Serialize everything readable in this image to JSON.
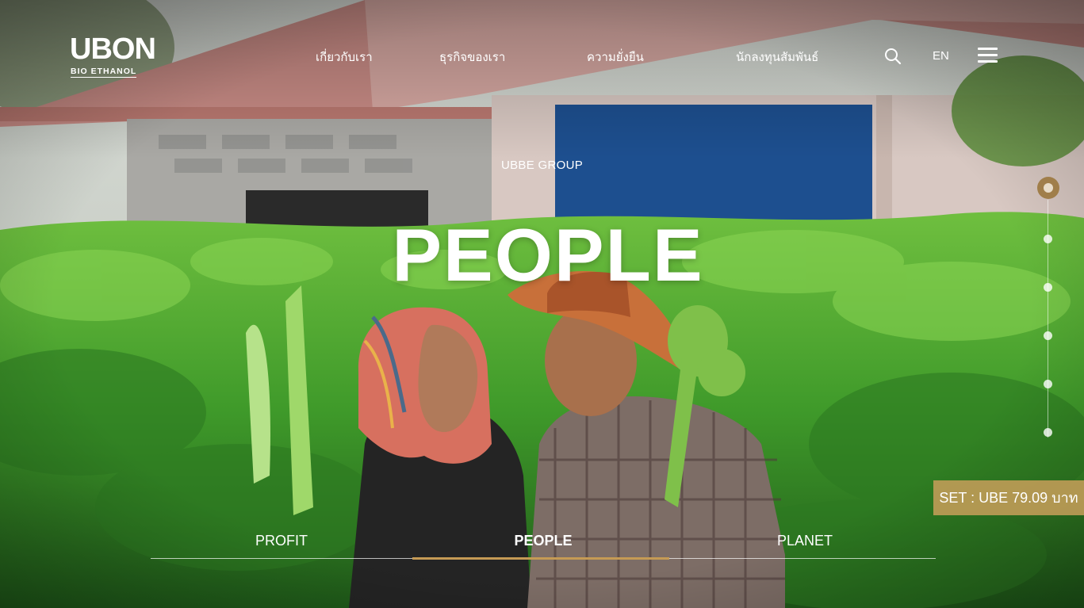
{
  "brand": {
    "name": "UBON",
    "tagline": "BIO ETHANOL"
  },
  "nav": {
    "items": [
      {
        "label": "เกี่ยวกับเรา"
      },
      {
        "label": "ธุรกิจของเรา"
      },
      {
        "label": "ความยั่งยืน"
      },
      {
        "label": "นักลงทุนสัมพันธ์"
      }
    ],
    "language": "EN"
  },
  "hero": {
    "eyebrow": "UBBE GROUP",
    "headline": "PEOPLE",
    "active_slide": 1,
    "slide_count": 6
  },
  "stock": {
    "text": "SET : UBE 79.09 บาท"
  },
  "tabs": [
    {
      "label": "PROFIT"
    },
    {
      "label": "PEOPLE"
    },
    {
      "label": "PLANET"
    }
  ],
  "colors": {
    "accent": "#c59a54",
    "stock_bg": "#c49d59"
  }
}
